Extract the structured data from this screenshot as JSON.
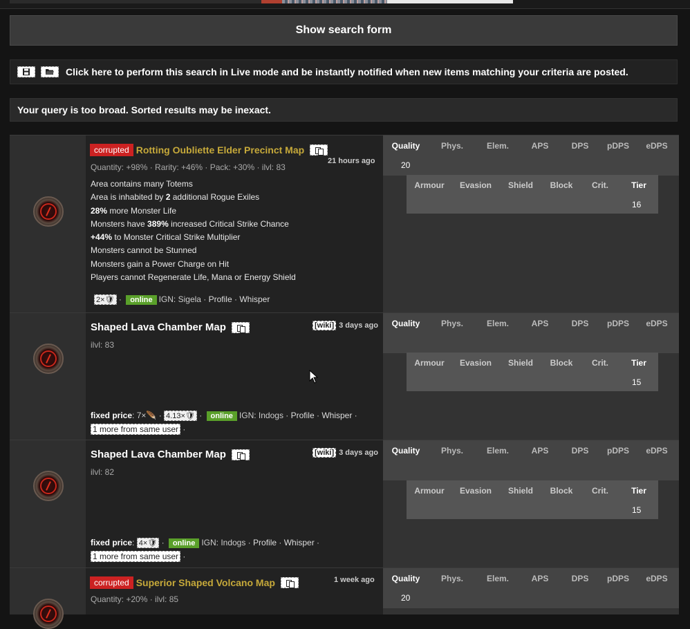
{
  "search": {
    "toggle_label": "Show search form"
  },
  "live": {
    "text": "Click here to perform this search in Live mode and be instantly notified when new items matching your criteria are posted."
  },
  "warning": {
    "text": "Your query is too broad. Sorted results may be inexact."
  },
  "table_headers": {
    "primary": [
      "Quality",
      "Phys.",
      "Elem.",
      "APS",
      "DPS",
      "pDPS",
      "eDPS"
    ],
    "secondary": [
      "Armour",
      "Evasion",
      "Shield",
      "Block",
      "Crit.",
      "Tier"
    ]
  },
  "items": [
    {
      "corrupted_label": "corrupted",
      "name": "Rotting Oubliette Elder Precinct Map",
      "age": "21 hours ago",
      "props": "Quantity: +98% · Rarity: +46% · Pack: +30% · ilvl: 83",
      "mods": [
        {
          "pre": "",
          "b": "",
          "post": "Area contains many Totems"
        },
        {
          "pre": "Area is inhabited by ",
          "b": "2",
          "post": " additional Rogue Exiles"
        },
        {
          "pre": "",
          "b": "28%",
          "post": " more Monster Life"
        },
        {
          "pre": "Monsters have ",
          "b": "389%",
          "post": " increased Critical Strike Chance"
        },
        {
          "pre": "",
          "b": "+44%",
          "post": " to Monster Critical Strike Multiplier"
        },
        {
          "pre": "",
          "b": "",
          "post": "Monsters cannot be Stunned"
        },
        {
          "pre": "",
          "b": "",
          "post": "Monsters gain a Power Charge on Hit"
        },
        {
          "pre": "",
          "b": "",
          "post": "Players cannot Regenerate Life, Mana or Energy Shield"
        }
      ],
      "price_chip": "2×",
      "online": "online",
      "ign": "IGN: Sigela",
      "profile": "Profile",
      "whisper": "Whisper",
      "quality": "20",
      "tier": "16"
    },
    {
      "name": "Shaped Lava Chamber Map",
      "wiki": "[wiki]",
      "age": "3 days ago",
      "props": "ilvl: 83",
      "fixed_label": "fixed price",
      "price_text": ": 7×",
      "price_chip": "4.13×",
      "online": "online",
      "ign": "IGN: Indogs",
      "profile": "Profile",
      "whisper": "Whisper",
      "more": "1 more from same user",
      "tier": "15"
    },
    {
      "name": "Shaped Lava Chamber Map",
      "wiki": "[wiki]",
      "age": "3 days ago",
      "props": "ilvl: 82",
      "fixed_label": "fixed price",
      "price_text": ":",
      "price_chip": "4×",
      "online": "online",
      "ign": "IGN: Indogs",
      "profile": "Profile",
      "whisper": "Whisper",
      "more": "1 more from same user",
      "tier": "15"
    },
    {
      "corrupted_label": "corrupted",
      "name": "Superior Shaped Volcano Map",
      "age": "1 week ago",
      "props": "Quantity: +20% · ilvl: 85",
      "quality": "20"
    }
  ]
}
